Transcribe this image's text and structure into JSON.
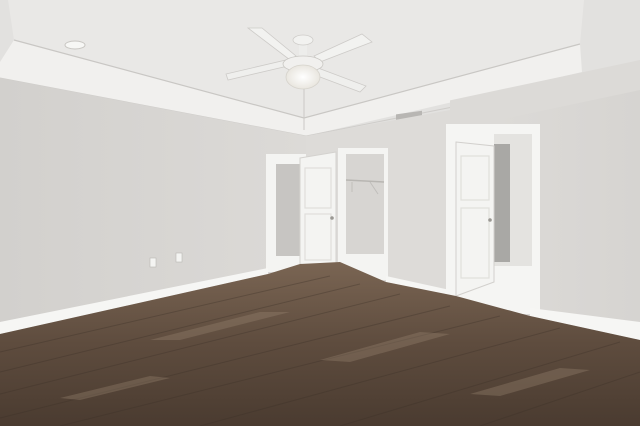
{
  "scene": {
    "description_tags": [
      "empty-bedroom",
      "tray-ceiling",
      "ceiling-fan",
      "hardwood-floor"
    ],
    "colors": {
      "ceiling": "#e6e6e4",
      "tray_ceiling": "#eceae8",
      "crown_molding": "#f2f1ef",
      "wall_left": "#d7d5d2",
      "wall_back": "#dddbd8",
      "wall_right": "#dedcd9",
      "trim": "#f6f6f4",
      "door": "#f4f4f2",
      "closet_interior": "#cfcdca",
      "floor_dark": "#4a3b30",
      "floor_mid": "#6b5848",
      "floor_light": "#8c7866",
      "fan_blade": "#f2f2f0",
      "fan_light": "#fbfaf6"
    },
    "fixtures": {
      "ceiling_fan": {
        "blades": 4,
        "has_light_kit": true,
        "pull_chain": true
      },
      "doors": [
        {
          "name": "closet-door-left",
          "state": "open"
        },
        {
          "name": "closet-door-center",
          "state": "open"
        },
        {
          "name": "bathroom-door-right",
          "state": "open"
        }
      ],
      "outlets": 2,
      "hvac_vent": true,
      "recessed_light": true
    }
  }
}
